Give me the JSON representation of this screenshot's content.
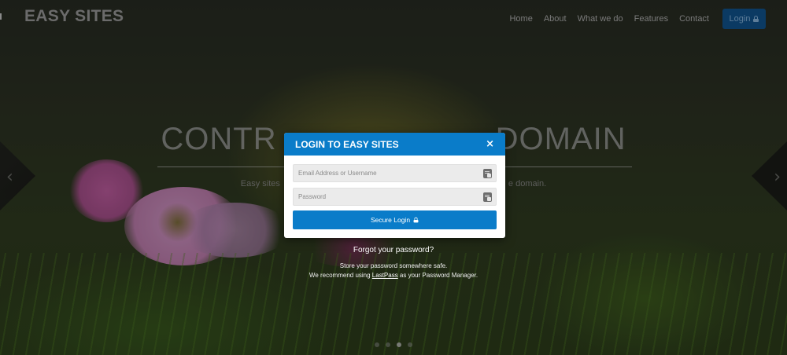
{
  "navbar": {
    "brand": "EASY SITES",
    "links": [
      "Home",
      "About",
      "What we do",
      "Features",
      "Contact"
    ],
    "login_label": "Login"
  },
  "hero": {
    "title_left": "CONTR",
    "title_right": "DOMAIN",
    "subtitle_left": "Easy sites",
    "subtitle_right": "e domain."
  },
  "modal": {
    "title": "LOGIN TO EASY SITES",
    "close_symbol": "×",
    "email_placeholder": "Email Address or Username",
    "password_placeholder": "Password",
    "submit_label": "Secure Login"
  },
  "help": {
    "forgot": "Forgot your password?",
    "line1": "Store your password somewhere safe.",
    "line2_prefix": "We recommend using ",
    "link": "LastPass",
    "line2_suffix": " as your Password Manager."
  },
  "carousel": {
    "slide_count": 4,
    "active_index": 2
  }
}
